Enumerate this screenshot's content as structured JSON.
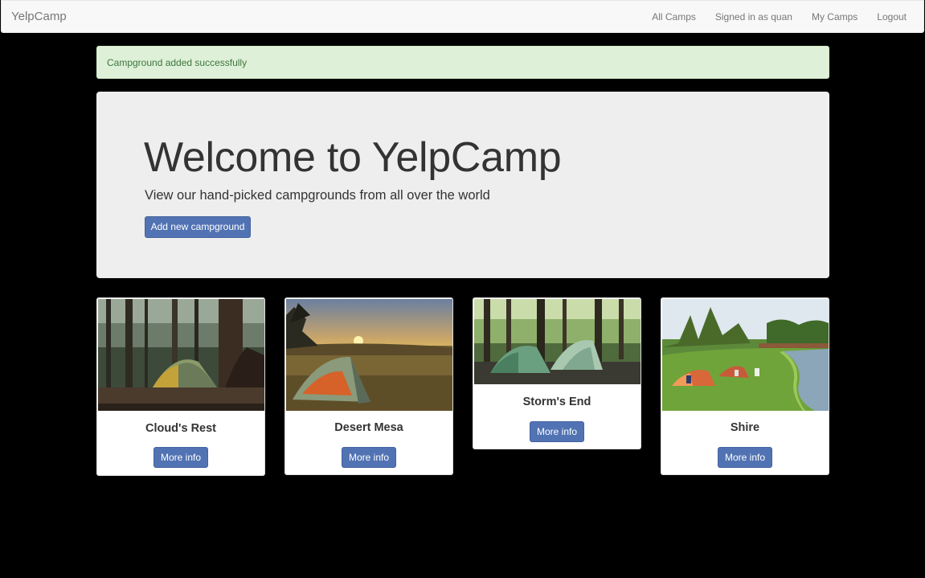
{
  "navbar": {
    "brand": "YelpCamp",
    "links": [
      "All Camps",
      "Signed in as quan",
      "My Camps",
      "Logout"
    ]
  },
  "flash": {
    "message": "Campground added successfully",
    "color": "#3c763d",
    "background": "#dff0d8"
  },
  "jumbotron": {
    "title": "Welcome to YelpCamp",
    "subtitle": "View our hand-picked campgrounds from all over the world",
    "button_label": "Add new campground"
  },
  "campgrounds": [
    {
      "name": "Cloud's Rest",
      "button_label": "More info",
      "image": "tent-in-forest"
    },
    {
      "name": "Desert Mesa",
      "button_label": "More info",
      "image": "tent-at-sunset"
    },
    {
      "name": "Storm's End",
      "button_label": "More info",
      "image": "tents-in-woods"
    },
    {
      "name": "Shire",
      "button_label": "More info",
      "image": "tents-by-river"
    }
  ],
  "colors": {
    "primary_button": "#5173b3",
    "page_background": "#000000",
    "navbar_background": "#f8f8f8",
    "jumbotron_background": "#eeeeee"
  }
}
